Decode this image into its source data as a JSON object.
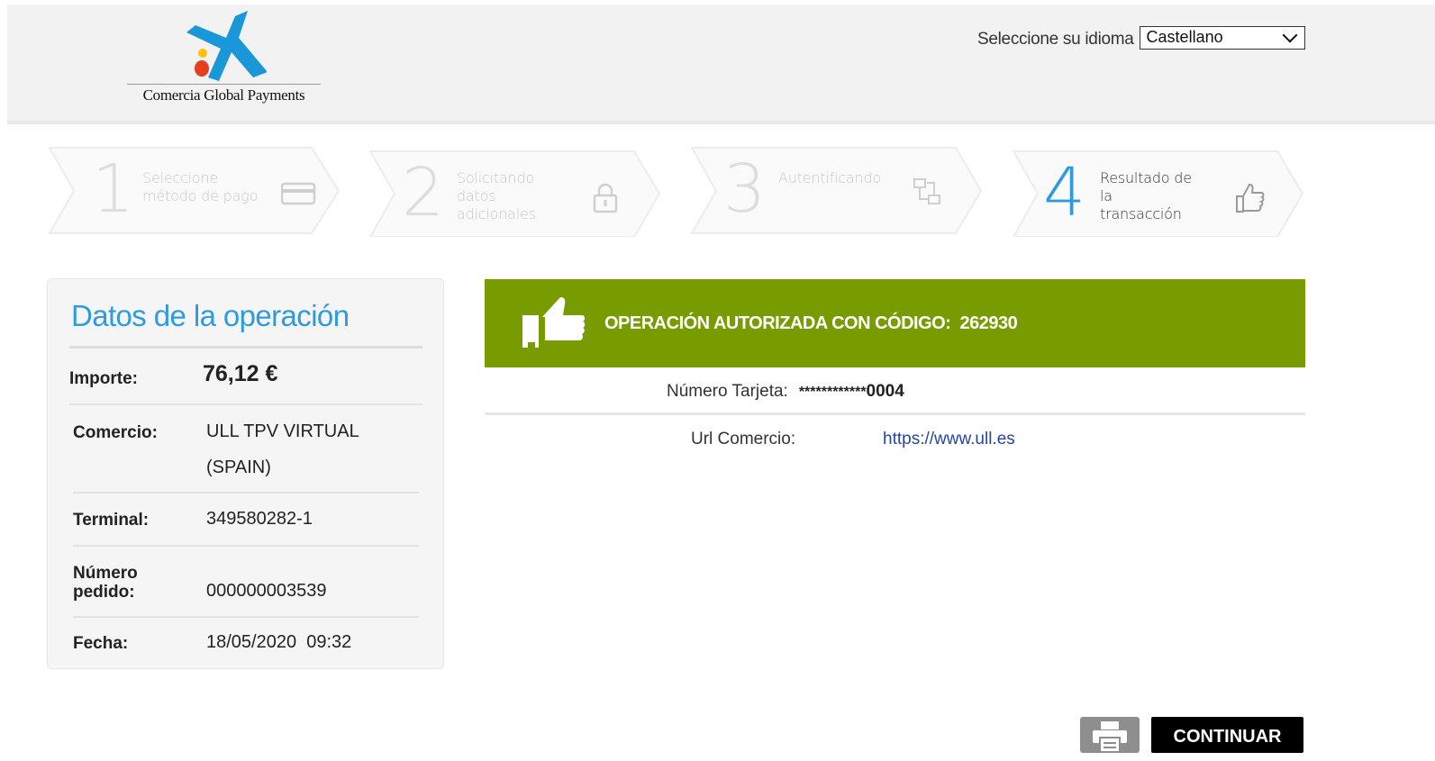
{
  "header": {
    "logo_text": "Comercia Global Payments",
    "language_label": "Seleccione su idioma",
    "language_selected": "Castellano"
  },
  "steps": [
    {
      "number": "1",
      "label": "Seleccione\nmétodo de pago",
      "icon": "credit-card-icon",
      "active": false
    },
    {
      "number": "2",
      "label": "Solicitando\ndatos\nadicionales",
      "icon": "lock-icon",
      "active": false
    },
    {
      "number": "3",
      "label": "Autentificando",
      "icon": "exchange-icon",
      "active": false
    },
    {
      "number": "4",
      "label": "Resultado de\nla\ntransacción",
      "icon": "thumbs-up-icon",
      "active": true
    }
  ],
  "operation": {
    "title": "Datos de la operación",
    "amount_label": "Importe:",
    "amount_value": "76,12 €",
    "merchant_label": "Comercio:",
    "merchant_value_line1": "ULL TPV VIRTUAL",
    "merchant_value_line2": "(SPAIN)",
    "terminal_label": "Terminal:",
    "terminal_value": "349580282-1",
    "order_label_line1": "Número",
    "order_label_line2": "pedido:",
    "order_value": "000000003539",
    "date_label": "Fecha:",
    "date_value": "18/05/2020  09:32"
  },
  "result": {
    "banner_text": "OPERACIÓN AUTORIZADA CON CÓDIGO:  262930",
    "card_number_label": "Número Tarjeta:",
    "card_number_masked": "************",
    "card_number_last4": "0004",
    "merchant_url_label": "Url Comercio:",
    "merchant_url": "https://www.ull.es"
  },
  "actions": {
    "print_icon": "printer-icon",
    "continue_label": "CONTINUAR"
  },
  "colors": {
    "accent_blue": "#2e9be0",
    "success_green": "#789b00",
    "link_blue": "#2446a6"
  }
}
